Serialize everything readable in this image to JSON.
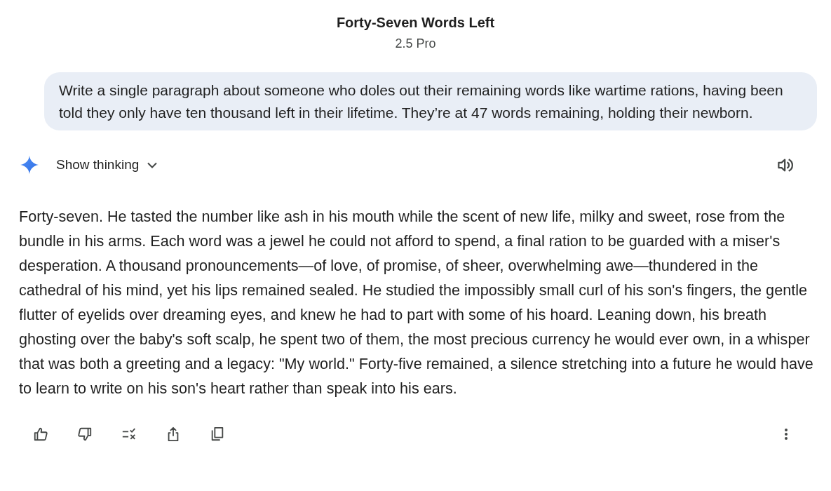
{
  "header": {
    "title": "Forty-Seven Words Left",
    "model": "2.5 Pro"
  },
  "prompt": {
    "text": "Write a single paragraph about someone who doles out their remaining words like wartime rations, having been told they only have ten thousand left in their lifetime. They’re at 47 words remaining, holding their newborn."
  },
  "response": {
    "thinking_toggle": {
      "label": "Show thinking",
      "expanded": false
    },
    "text": "Forty-seven. He tasted the number like ash in his mouth while the scent of new life, milky and sweet, rose from the bundle in his arms. Each word was a jewel he could not afford to spend, a final ration to be guarded with a miser's desperation. A thousand pronouncements—of love, of promise, of sheer, overwhelming awe—thundered in the cathedral of his mind, yet his lips remained sealed. He studied the impossibly small curl of his son's fingers, the gentle flutter of eyelids over dreaming eyes, and knew he had to part with some of his hoard. Leaning down, his breath ghosting over the baby's soft scalp, he spent two of them, the most precious currency he would ever own, in a whisper that was both a greeting and a legacy: \"My world.\" Forty-five remained, a silence stretching into a future he would have to learn to write on his son's heart rather than speak into his ears."
  }
}
